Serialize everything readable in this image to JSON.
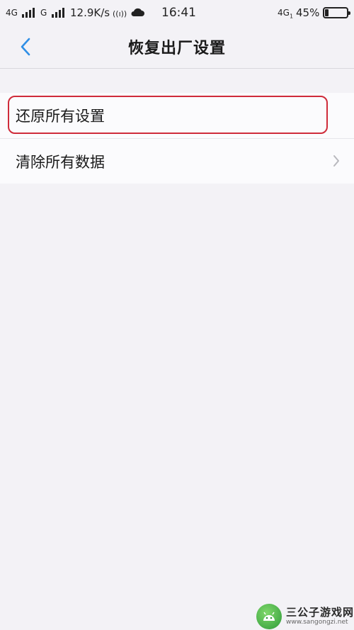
{
  "status_bar": {
    "network1": "4G",
    "network2": "G",
    "speed": "12.9K/s",
    "hotspot_glyph": "((ı))",
    "weather_icon": "cloud-icon",
    "time": "16:41",
    "network3": "4G",
    "network3_sub": "1",
    "battery": "45%",
    "battery_level": 0.15
  },
  "nav": {
    "back_icon": "chevron-left-icon",
    "title": "恢复出厂设置"
  },
  "settings": {
    "items": [
      {
        "label": "还原所有设置",
        "highlighted": true
      },
      {
        "label": "清除所有数据",
        "chevron": true
      }
    ]
  },
  "watermark": {
    "title": "三公子游戏网",
    "url": "www.sangongzi.net"
  },
  "colors": {
    "accent": "#2f8fe6",
    "highlight_border": "#cf2b3a",
    "background": "#f3f2f6"
  }
}
